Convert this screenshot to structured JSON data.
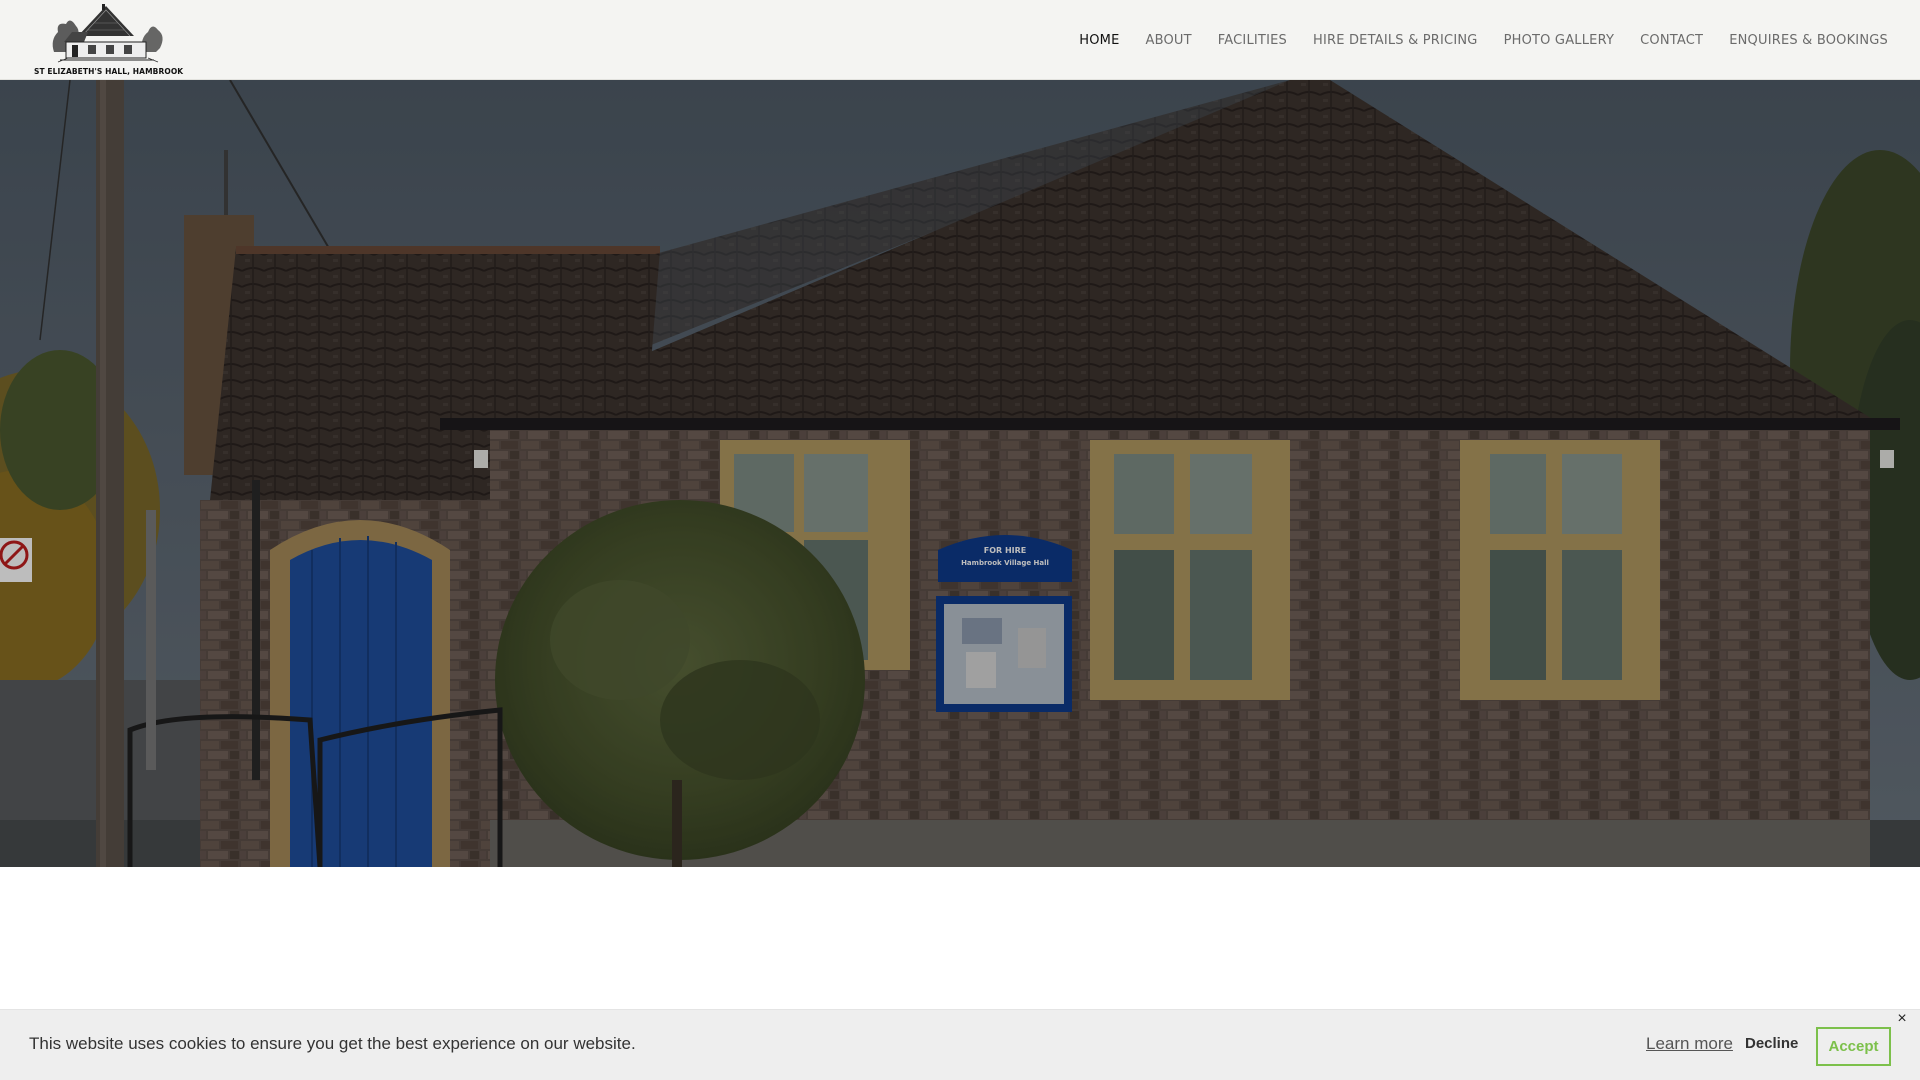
{
  "site": {
    "logo_text": "ST ELIZABETH'S HALL, HAMBROOK"
  },
  "nav": {
    "items": [
      {
        "label": "HOME",
        "active": true
      },
      {
        "label": "ABOUT"
      },
      {
        "label": "FACILITIES"
      },
      {
        "label": "HIRE DETAILS & PRICING"
      },
      {
        "label": "PHOTO GALLERY"
      },
      {
        "label": "CONTACT"
      },
      {
        "label": "ENQUIRES & BOOKINGS"
      }
    ]
  },
  "hero": {
    "sign_line1": "FOR HIRE",
    "sign_line2": "Hambrook Village Hall"
  },
  "cookie": {
    "message": "This website uses cookies to ensure you get the best experience on our website.",
    "learn_more": "Learn more",
    "decline": "Decline",
    "accept": "Accept",
    "close": "×",
    "accent_color": "#7cc04b"
  },
  "icons": {
    "logo": "hall-building-sketch",
    "close": "close-icon"
  }
}
